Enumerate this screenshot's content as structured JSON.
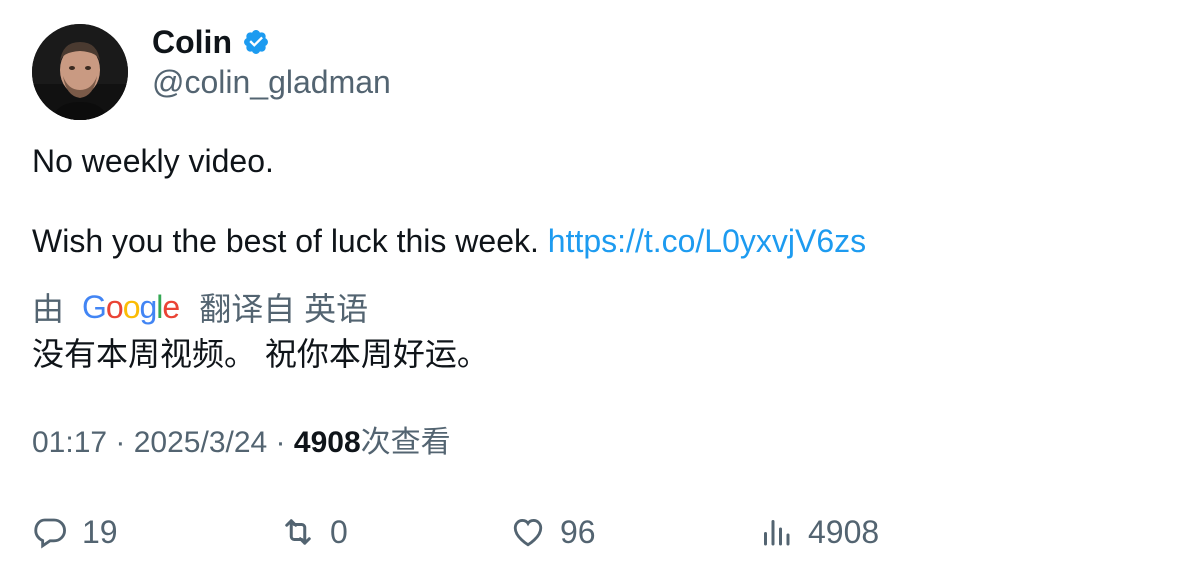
{
  "author": {
    "display_name": "Colin",
    "handle": "@colin_gladman",
    "verified_icon": "verified-badge-icon",
    "badge_color": "#1d9bf0"
  },
  "tweet": {
    "line1": "No weekly video.",
    "line2_text": "Wish you the best of luck this week. ",
    "link": "https://t.co/L0yxvjV6zs",
    "link_color": "#1d9bf0"
  },
  "translation": {
    "prefix": "由",
    "provider_letters": [
      "G",
      "o",
      "o",
      "g",
      "l",
      "e"
    ],
    "suffix": "翻译自 英语",
    "text": "没有本周视频。 祝你本周好运。"
  },
  "meta": {
    "time": "01:17",
    "separator": " · ",
    "date": "2025/3/24",
    "views_count": "4908",
    "views_label": "次查看"
  },
  "actions": {
    "reply_count": "19",
    "retweet_count": "0",
    "like_count": "96",
    "views_count": "4908"
  }
}
